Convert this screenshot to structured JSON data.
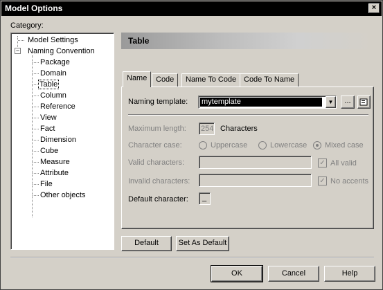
{
  "window": {
    "title": "Model Options",
    "close_label": "×"
  },
  "category": {
    "label": "Category:",
    "tree": [
      {
        "label": "Model Settings"
      },
      {
        "label": "Naming Convention",
        "expander": "−"
      },
      {
        "label": "Package"
      },
      {
        "label": "Domain"
      },
      {
        "label": "Table"
      },
      {
        "label": "Column"
      },
      {
        "label": "Reference"
      },
      {
        "label": "View"
      },
      {
        "label": "Fact"
      },
      {
        "label": "Dimension"
      },
      {
        "label": "Cube"
      },
      {
        "label": "Measure"
      },
      {
        "label": "Attribute"
      },
      {
        "label": "File"
      },
      {
        "label": "Other objects"
      }
    ]
  },
  "header": {
    "title": "Table"
  },
  "tabs": [
    {
      "label": "Name"
    },
    {
      "label": "Code"
    },
    {
      "label": "Name To Code"
    },
    {
      "label": "Code To Name"
    }
  ],
  "form": {
    "naming_template_label": "Naming template:",
    "naming_template_value": "mytemplate",
    "dropdown_arrow": "▼",
    "ellipsis": "...",
    "max_length_label": "Maximum length:",
    "max_length_value": "254",
    "characters_label": "Characters",
    "character_case_label": "Character case:",
    "case_options": [
      {
        "label": "Uppercase",
        "selected": false
      },
      {
        "label": "Lowercase",
        "selected": false
      },
      {
        "label": "Mixed case",
        "selected": true
      }
    ],
    "valid_chars_label": "Valid characters:",
    "valid_chars_value": "",
    "all_valid_label": "All valid",
    "all_valid_checked": true,
    "invalid_chars_label": "Invalid characters:",
    "invalid_chars_value": "",
    "no_accents_label": "No accents",
    "no_accents_checked": true,
    "default_char_label": "Default character:",
    "default_char_value": "_",
    "check_mark": "✓"
  },
  "buttons": {
    "default": "Default",
    "set_as_default": "Set As Default",
    "ok": "OK",
    "cancel": "Cancel",
    "help": "Help"
  }
}
